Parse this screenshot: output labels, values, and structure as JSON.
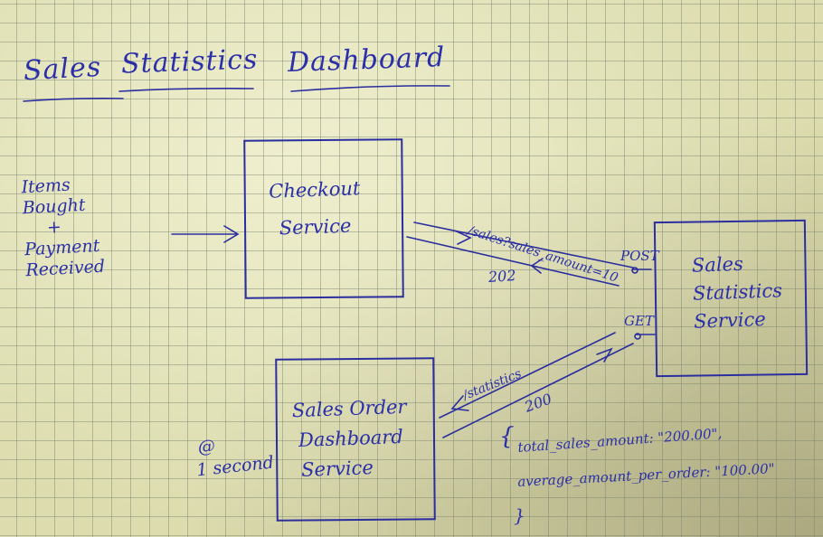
{
  "title": {
    "words": [
      "Sales",
      "Statistics",
      "Dashboard"
    ]
  },
  "input_notes": {
    "lines": [
      "Items",
      "Bought",
      "+",
      "Payment",
      "Received"
    ]
  },
  "checkout_service": {
    "line1": "Checkout",
    "line2": "Service"
  },
  "sales_statistics_service": {
    "line1": "Sales",
    "line2": "Statistics",
    "line3": "Service"
  },
  "dashboard_service": {
    "line1": "Sales Order",
    "line2": "Dashboard",
    "line3": "Service"
  },
  "post_request": {
    "path": "/sales?sales_amount=10",
    "method": "POST",
    "response": "202"
  },
  "get_request": {
    "path": "/statistics",
    "method": "GET",
    "response": "200"
  },
  "poll_note": {
    "at": "@",
    "interval": "1 second"
  },
  "response_body": {
    "open": "{",
    "line1": "total_sales_amount: \"200.00\",",
    "line2": "average_amount_per_order: \"100.00\"",
    "close": "}"
  },
  "colors": {
    "ink": "#2b2fa8",
    "paper": "#dcdcae"
  }
}
